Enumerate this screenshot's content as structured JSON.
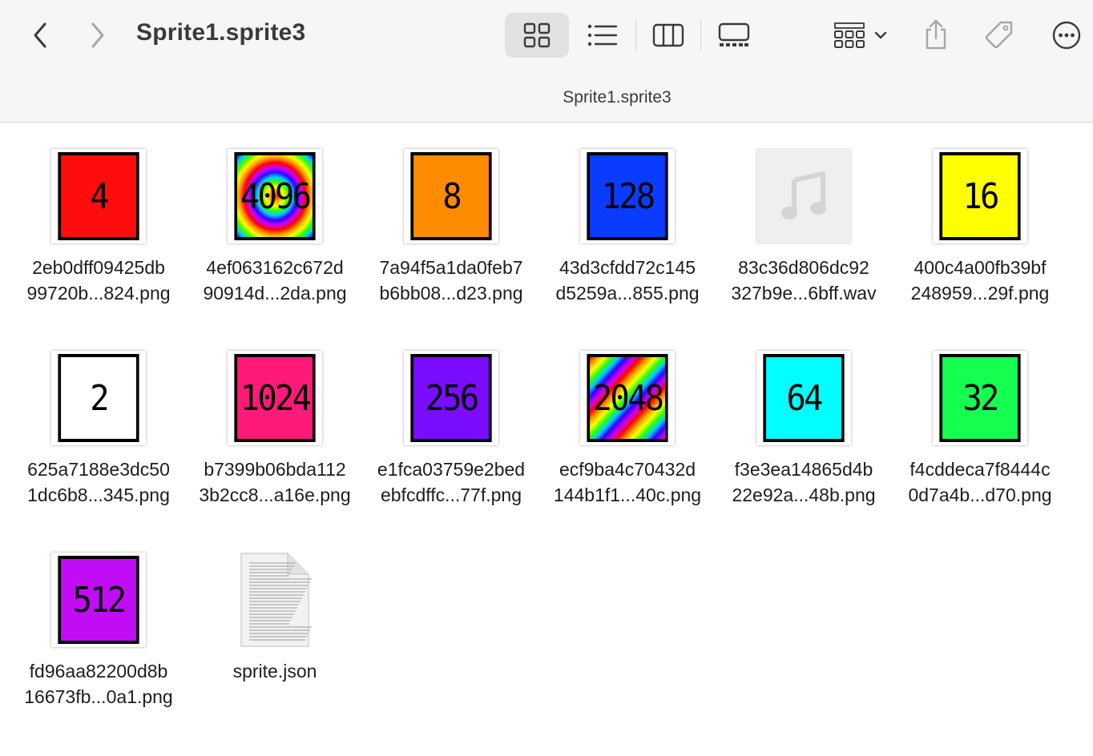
{
  "window": {
    "title": "Sprite1.sprite3",
    "path_title": "Sprite1.sprite3"
  },
  "toolbar": {
    "back": "chevron-left-icon",
    "forward": "chevron-right-icon",
    "views": [
      "icon-view-icon",
      "list-view-icon",
      "column-view-icon",
      "gallery-view-icon"
    ],
    "selected_view": "icon-view-icon",
    "group": "group-by-icon",
    "share": "share-icon",
    "tags": "tag-icon",
    "more": "more-icon"
  },
  "files": [
    {
      "line1": "2eb0dff09425db",
      "line2": "99720b...824.png",
      "kind": "png",
      "label": "4",
      "bg": "#ff0d0d"
    },
    {
      "line1": "4ef063162c672d",
      "line2": "90914d...2da.png",
      "kind": "png",
      "label": "4096",
      "bg": "rainbow-radial"
    },
    {
      "line1": "7a94f5a1da0feb7",
      "line2": "b6bb08...d23.png",
      "kind": "png",
      "label": "8",
      "bg": "#ff8c00"
    },
    {
      "line1": "43d3cfdd72c145",
      "line2": "d5259a...855.png",
      "kind": "png",
      "label": "128",
      "bg": "#0a3cff"
    },
    {
      "line1": "83c36d806dc92",
      "line2": "327b9e...6bff.wav",
      "kind": "wav",
      "label": "",
      "bg": "#efefef"
    },
    {
      "line1": "400c4a00fb39bf",
      "line2": "248959...29f.png",
      "kind": "png",
      "label": "16",
      "bg": "#ffff00"
    },
    {
      "line1": "625a7188e3dc50",
      "line2": "1dc6b8...345.png",
      "kind": "png",
      "label": "2",
      "bg": "#ffffff"
    },
    {
      "line1": "b7399b06bda112",
      "line2": "3b2cc8...a16e.png",
      "kind": "png",
      "label": "1024",
      "bg": "#ff1a7a"
    },
    {
      "line1": "e1fca03759e2bed",
      "line2": "ebfcdffc...77f.png",
      "kind": "png",
      "label": "256",
      "bg": "#7a0cff"
    },
    {
      "line1": "ecf9ba4c70432d",
      "line2": "144b1f1...40c.png",
      "kind": "png",
      "label": "2048",
      "bg": "rainbow-diagonal"
    },
    {
      "line1": "f3e3ea14865d4b",
      "line2": "22e92a...48b.png",
      "kind": "png",
      "label": "64",
      "bg": "#00ffff"
    },
    {
      "line1": "f4cddeca7f8444c",
      "line2": "0d7a4b...d70.png",
      "kind": "png",
      "label": "32",
      "bg": "#14ff50"
    },
    {
      "line1": "fd96aa82200d8b",
      "line2": "16673fb...0a1.png",
      "kind": "png",
      "label": "512",
      "bg": "#c20cf5"
    },
    {
      "line1": "sprite.json",
      "line2": "",
      "kind": "json",
      "label": "",
      "bg": "#f2f2f2"
    }
  ]
}
